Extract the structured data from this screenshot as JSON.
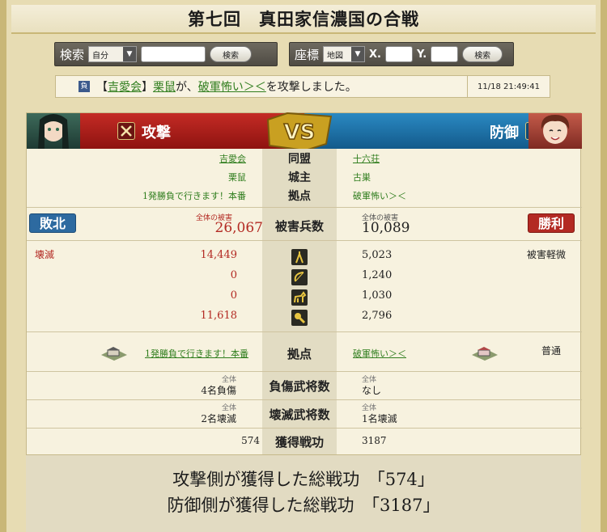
{
  "title": "第七回　真田家信濃国の合戦",
  "search": {
    "label": "検索",
    "select": "自分",
    "button": "検索"
  },
  "coords": {
    "label": "座標",
    "select": "地図",
    "x_label": "X.",
    "y_label": "Y.",
    "button": "検索"
  },
  "log": {
    "result_badge": "負",
    "bracket_open": "【",
    "alliance": "吉愛会",
    "bracket_close": "】",
    "attacker": "栗鼠",
    "mid": "が、",
    "target": "破軍怖い＞＜",
    "tail": "を攻撃しました。",
    "timestamp": "11/18 21:49:41"
  },
  "vs": {
    "attack_label": "攻撃",
    "defense_label": "防御",
    "logo": "VS"
  },
  "info": {
    "alliance": {
      "label": "同盟",
      "attacker": "吉愛会",
      "defender": "十六荘"
    },
    "lord": {
      "label": "城主",
      "attacker": "栗鼠",
      "defender": "古巣"
    },
    "base": {
      "label": "拠点",
      "attacker": "1発勝負で行きます！本番",
      "defender": "破軍怖い＞＜"
    }
  },
  "damage": {
    "label": "被害兵数",
    "attacker_result": "敗北",
    "defender_result": "勝利",
    "attacker_caption": "全体の被害",
    "defender_caption": "全体の被害",
    "attacker_total": "26,067",
    "defender_total": "10,089"
  },
  "units": {
    "attacker_status": "壊滅",
    "defender_status": "被害軽微",
    "rows": [
      {
        "icon": "spearman-icon",
        "attacker": "14,449",
        "defender": "5,023"
      },
      {
        "icon": "archer-icon",
        "attacker": "0",
        "defender": "1,240"
      },
      {
        "icon": "cavalry-icon",
        "attacker": "0",
        "defender": "1,030"
      },
      {
        "icon": "siege-icon",
        "attacker": "11,618",
        "defender": "2,796"
      }
    ]
  },
  "base_row": {
    "label": "拠点",
    "attacker": "1発勝負で行きます！本番",
    "defender": "破軍怖い＞＜",
    "defender_status": "普通"
  },
  "injured": {
    "label": "負傷武将数",
    "caption": "全体",
    "attacker": "4名負傷",
    "defender": "なし"
  },
  "destroyed": {
    "label": "壊滅武将数",
    "caption": "全体",
    "attacker": "2名壊滅",
    "defender": "1名壊滅"
  },
  "merit": {
    "label": "獲得戦功",
    "attacker": "574",
    "defender": "3187"
  },
  "summary": {
    "attack_text": "攻撃側が獲得した総戦功",
    "attack_value": "「574」",
    "defense_text": "防御側が獲得した総戦功",
    "defense_value": "「3187」"
  },
  "colors": {
    "attack_red": "#b32a23",
    "defense_blue": "#1d6fa5",
    "link_green": "#2f7d1d"
  }
}
